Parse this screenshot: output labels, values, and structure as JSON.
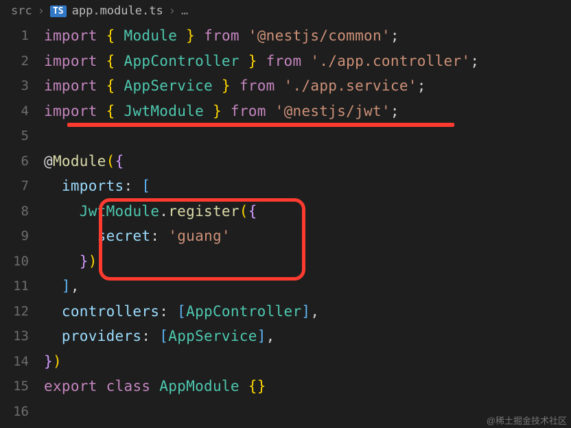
{
  "breadcrumb": {
    "folder": "src",
    "badge": "TS",
    "file": "app.module.ts",
    "more": "…"
  },
  "lines": [
    {
      "n": "1",
      "tokens": [
        [
          "kw",
          "import"
        ],
        [
          "punct",
          " "
        ],
        [
          "brace",
          "{"
        ],
        [
          "punct",
          " "
        ],
        [
          "ident",
          "Module"
        ],
        [
          "punct",
          " "
        ],
        [
          "brace",
          "}"
        ],
        [
          "punct",
          " "
        ],
        [
          "kw",
          "from"
        ],
        [
          "punct",
          " "
        ],
        [
          "str",
          "'@nestjs/common'"
        ],
        [
          "punct",
          ";"
        ]
      ]
    },
    {
      "n": "2",
      "tokens": [
        [
          "kw",
          "import"
        ],
        [
          "punct",
          " "
        ],
        [
          "brace",
          "{"
        ],
        [
          "punct",
          " "
        ],
        [
          "ident",
          "AppController"
        ],
        [
          "punct",
          " "
        ],
        [
          "brace",
          "}"
        ],
        [
          "punct",
          " "
        ],
        [
          "kw",
          "from"
        ],
        [
          "punct",
          " "
        ],
        [
          "str",
          "'./app.controller'"
        ],
        [
          "punct",
          ";"
        ]
      ]
    },
    {
      "n": "3",
      "tokens": [
        [
          "kw",
          "import"
        ],
        [
          "punct",
          " "
        ],
        [
          "brace",
          "{"
        ],
        [
          "punct",
          " "
        ],
        [
          "ident",
          "AppService"
        ],
        [
          "punct",
          " "
        ],
        [
          "brace",
          "}"
        ],
        [
          "punct",
          " "
        ],
        [
          "kw",
          "from"
        ],
        [
          "punct",
          " "
        ],
        [
          "str",
          "'./app.service'"
        ],
        [
          "punct",
          ";"
        ]
      ]
    },
    {
      "n": "4",
      "tokens": [
        [
          "kw",
          "import"
        ],
        [
          "punct",
          " "
        ],
        [
          "brace",
          "{"
        ],
        [
          "punct",
          " "
        ],
        [
          "ident",
          "JwtModule"
        ],
        [
          "punct",
          " "
        ],
        [
          "brace",
          "}"
        ],
        [
          "punct",
          " "
        ],
        [
          "kw",
          "from"
        ],
        [
          "punct",
          " "
        ],
        [
          "str",
          "'@nestjs/jwt'"
        ],
        [
          "punct",
          ";"
        ]
      ]
    },
    {
      "n": "5",
      "tokens": []
    },
    {
      "n": "6",
      "tokens": [
        [
          "punct",
          "@"
        ],
        [
          "method",
          "Module"
        ],
        [
          "bracket-yellow",
          "("
        ],
        [
          "bracket-purple",
          "{"
        ]
      ]
    },
    {
      "n": "7",
      "tokens": [
        [
          "punct",
          "  "
        ],
        [
          "prop",
          "imports"
        ],
        [
          "punct",
          ":"
        ],
        [
          "punct",
          " "
        ],
        [
          "bracket-blue",
          "["
        ]
      ]
    },
    {
      "n": "8",
      "tokens": [
        [
          "punct",
          "    "
        ],
        [
          "ident",
          "JwtModule"
        ],
        [
          "punct",
          "."
        ],
        [
          "method",
          "register"
        ],
        [
          "bracket-yellow",
          "("
        ],
        [
          "bracket-purple",
          "{"
        ]
      ]
    },
    {
      "n": "9",
      "tokens": [
        [
          "punct",
          "      "
        ],
        [
          "prop",
          "secret"
        ],
        [
          "punct",
          ":"
        ],
        [
          "punct",
          " "
        ],
        [
          "str",
          "'guang'"
        ]
      ]
    },
    {
      "n": "10",
      "tokens": [
        [
          "punct",
          "    "
        ],
        [
          "bracket-purple",
          "}"
        ],
        [
          "bracket-yellow",
          ")"
        ]
      ]
    },
    {
      "n": "11",
      "tokens": [
        [
          "punct",
          "  "
        ],
        [
          "bracket-blue",
          "]"
        ],
        [
          "punct",
          ","
        ]
      ]
    },
    {
      "n": "12",
      "tokens": [
        [
          "punct",
          "  "
        ],
        [
          "prop",
          "controllers"
        ],
        [
          "punct",
          ":"
        ],
        [
          "punct",
          " "
        ],
        [
          "bracket-blue",
          "["
        ],
        [
          "ident",
          "AppController"
        ],
        [
          "bracket-blue",
          "]"
        ],
        [
          "punct",
          ","
        ]
      ]
    },
    {
      "n": "13",
      "tokens": [
        [
          "punct",
          "  "
        ],
        [
          "prop",
          "providers"
        ],
        [
          "punct",
          ":"
        ],
        [
          "punct",
          " "
        ],
        [
          "bracket-blue",
          "["
        ],
        [
          "ident",
          "AppService"
        ],
        [
          "bracket-blue",
          "]"
        ],
        [
          "punct",
          ","
        ]
      ]
    },
    {
      "n": "14",
      "tokens": [
        [
          "bracket-purple",
          "}"
        ],
        [
          "bracket-yellow",
          ")"
        ]
      ]
    },
    {
      "n": "15",
      "tokens": [
        [
          "kw",
          "export"
        ],
        [
          "punct",
          " "
        ],
        [
          "kw",
          "class"
        ],
        [
          "punct",
          " "
        ],
        [
          "ident",
          "AppModule"
        ],
        [
          "punct",
          " "
        ],
        [
          "brace",
          "{"
        ],
        [
          "brace",
          "}"
        ]
      ]
    },
    {
      "n": "16",
      "tokens": []
    }
  ],
  "watermark": "@稀土掘金技术社区"
}
